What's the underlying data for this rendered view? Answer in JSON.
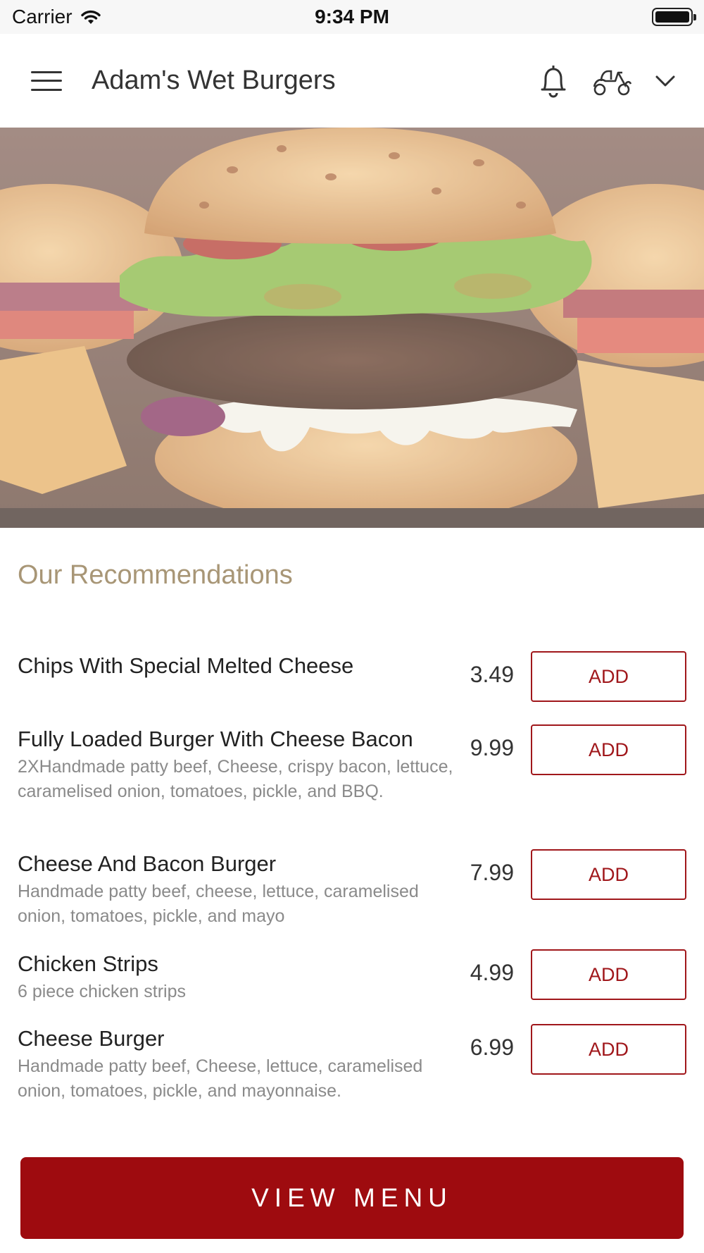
{
  "status_bar": {
    "carrier": "Carrier",
    "time": "9:34 PM"
  },
  "header": {
    "title": "Adam's Wet Burgers"
  },
  "icons": {
    "menu": "hamburger-menu-icon",
    "bell": "bell-icon",
    "delivery": "scooter-icon",
    "dropdown": "chevron-down-icon"
  },
  "section": {
    "title": "Our Recommendations"
  },
  "items": [
    {
      "name": "Chips With Special Melted Cheese",
      "description": "",
      "price": "3.49",
      "add_label": "ADD"
    },
    {
      "name": "Fully Loaded Burger With Cheese Bacon",
      "description": "2XHandmade patty beef, Cheese, crispy bacon, lettuce, caramelised onion, tomatoes, pickle, and BBQ.",
      "price": "9.99",
      "add_label": "ADD"
    },
    {
      "name": "Cheese And Bacon Burger",
      "description": "Handmade patty beef, cheese, lettuce, caramelised onion, tomatoes, pickle, and mayo",
      "price": "7.99",
      "add_label": "ADD"
    },
    {
      "name": "Chicken Strips",
      "description": "6 piece chicken strips",
      "price": "4.99",
      "add_label": "ADD"
    },
    {
      "name": "Cheese Burger",
      "description": "Handmade patty beef, Cheese, lettuce, caramelised onion, tomatoes, pickle, and mayonnaise.",
      "price": "6.99",
      "add_label": "ADD"
    }
  ],
  "footer": {
    "view_menu_label": "VIEW MENU"
  },
  "colors": {
    "accent": "#9e0b0f",
    "section_title": "#a89676"
  }
}
